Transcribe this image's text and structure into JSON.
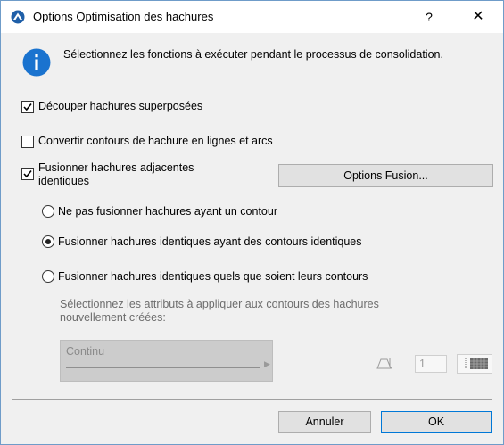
{
  "window": {
    "title": "Options Optimisation des hachures",
    "help_label": "?",
    "close_label": "✕"
  },
  "info": {
    "icon": "info-icon",
    "text": "Sélectionnez les fonctions à exécuter pendant le processus de consolidation."
  },
  "options": {
    "split_overlapping": {
      "label": "Découper hachures superposées",
      "checked": true
    },
    "convert_contours": {
      "label": "Convertir contours de hachure en lignes et arcs",
      "checked": false
    },
    "merge_adjacent": {
      "label_line1": "Fusionner hachures adjacentes",
      "label_line2": "identiques",
      "checked": true
    }
  },
  "merge_options_button": "Options Fusion...",
  "radios": [
    {
      "label": "Ne pas fusionner hachures ayant un contour",
      "selected": false
    },
    {
      "label": "Fusionner hachures identiques ayant des contours identiques",
      "selected": true
    },
    {
      "label": "Fusionner hachures identiques quels que soient leurs contours",
      "selected": false
    }
  ],
  "contour_attributes": {
    "label_line1": "Sélectionnez les attributs à appliquer aux contours des hachures",
    "label_line2": "nouvellement créées:",
    "line_type_value": "Continu",
    "pen_value": "1"
  },
  "footer": {
    "cancel_label": "Annuler",
    "ok_label": "OK"
  },
  "colors": {
    "accent": "#0078d7",
    "window_border": "#6f9cc9",
    "dialog_bg": "#f0f0f0"
  }
}
